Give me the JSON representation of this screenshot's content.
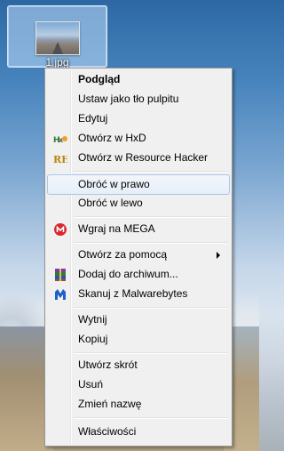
{
  "desktop": {
    "icon_label": "1.jpg"
  },
  "menu": {
    "items": [
      {
        "label": "Podgląd",
        "bold": true
      },
      {
        "label": "Ustaw jako tło pulpitu"
      },
      {
        "label": "Edytuj"
      },
      {
        "label": "Otwórz w HxD",
        "icon": "hxd-icon"
      },
      {
        "label": "Otwórz w Resource Hacker",
        "icon": "resource-hacker-icon"
      },
      {
        "label": "Obróć w prawo"
      },
      {
        "label": "Obróć w lewo"
      },
      {
        "label": "Wgraj na MEGA",
        "icon": "mega-icon"
      },
      {
        "label": "Otwórz za pomocą"
      },
      {
        "label": "Dodaj do archiwum...",
        "icon": "winrar-icon"
      },
      {
        "label": "Skanuj z Malwarebytes",
        "icon": "malwarebytes-icon"
      },
      {
        "label": "Wytnij"
      },
      {
        "label": "Kopiuj"
      },
      {
        "label": "Utwórz skrót"
      },
      {
        "label": "Usuń"
      },
      {
        "label": "Zmień nazwę"
      },
      {
        "label": "Właściwości"
      }
    ],
    "colors": {
      "background": "#f0f0f0",
      "hover_border": "#a8c6ea",
      "mega_red": "#d9272e"
    }
  }
}
